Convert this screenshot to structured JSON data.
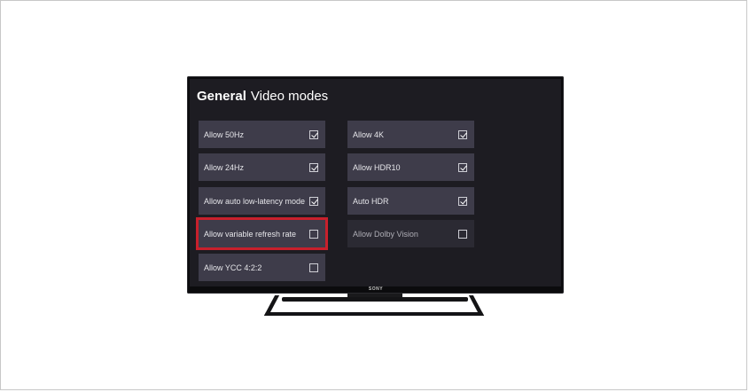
{
  "header": {
    "title_bold": "General",
    "title_light": "Video modes"
  },
  "tv": {
    "brand": "SONY"
  },
  "left_column": [
    {
      "label": "Allow 50Hz",
      "checked": true
    },
    {
      "label": "Allow 24Hz",
      "checked": true
    },
    {
      "label": "Allow auto low-latency mode",
      "checked": true
    },
    {
      "label": "Allow variable refresh rate",
      "checked": false,
      "highlighted": true
    },
    {
      "label": "Allow YCC 4:2:2",
      "checked": false
    }
  ],
  "right_column": [
    {
      "label": "Allow 4K",
      "checked": true
    },
    {
      "label": "Allow HDR10",
      "checked": true
    },
    {
      "label": "Auto HDR",
      "checked": true
    },
    {
      "label": "Allow Dolby Vision",
      "checked": false
    }
  ],
  "colors": {
    "highlight": "#c8202c",
    "tile": "#3e3c4a",
    "screen": "#1d1c22"
  }
}
